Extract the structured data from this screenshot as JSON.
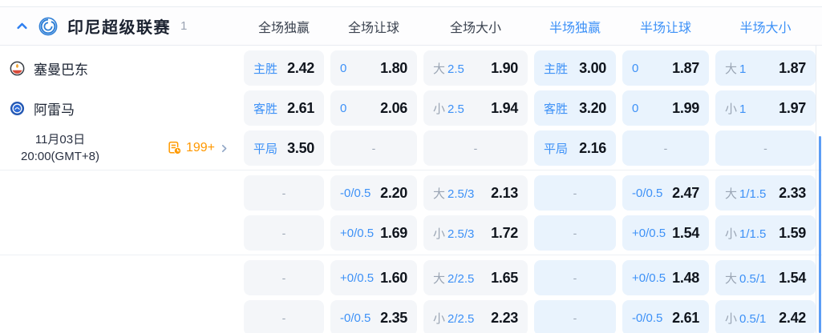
{
  "accent_color": "#3d91f7",
  "orange_color": "#ff9800",
  "header": {
    "league": "印尼超级联赛",
    "count": "1",
    "columns": [
      {
        "label": "全场独赢",
        "scope": "full"
      },
      {
        "label": "全场让球",
        "scope": "full"
      },
      {
        "label": "全场大小",
        "scope": "full"
      },
      {
        "label": "半场独赢",
        "scope": "half"
      },
      {
        "label": "半场让球",
        "scope": "half"
      },
      {
        "label": "半场大小",
        "scope": "half"
      }
    ]
  },
  "match": {
    "home_team": "塞曼巴东",
    "away_team": "阿雷马",
    "date": "11月03日",
    "time": "20:00(GMT+8)",
    "more_markets_count": "199+"
  },
  "icons": {
    "collapse": "chevron-up-icon",
    "league": "league-crest-icon",
    "home": "home-team-crest-icon",
    "away": "away-team-crest-icon",
    "markets": "markets-clock-icon",
    "more": "chevron-right-icon"
  },
  "groups": [
    {
      "rows": [
        {
          "left": "home",
          "cells": [
            {
              "label": "主胜",
              "value": "2.42"
            },
            {
              "label": "0",
              "value": "1.80"
            },
            {
              "prefix": "大",
              "label": "2.5",
              "value": "1.90"
            },
            {
              "label": "主胜",
              "value": "3.00"
            },
            {
              "label": "0",
              "value": "1.87"
            },
            {
              "prefix": "大",
              "label": "1",
              "value": "1.87"
            }
          ]
        },
        {
          "left": "away",
          "cells": [
            {
              "label": "客胜",
              "value": "2.61"
            },
            {
              "label": "0",
              "value": "2.06"
            },
            {
              "prefix": "小",
              "label": "2.5",
              "value": "1.94"
            },
            {
              "label": "客胜",
              "value": "3.20"
            },
            {
              "label": "0",
              "value": "1.99"
            },
            {
              "prefix": "小",
              "label": "1",
              "value": "1.97"
            }
          ]
        },
        {
          "left": "meta",
          "cells": [
            {
              "label": "平局",
              "value": "3.50"
            },
            {
              "dash": "-"
            },
            {
              "dash": "-"
            },
            {
              "label": "平局",
              "value": "2.16"
            },
            {
              "dash": "-"
            },
            {
              "dash": "-"
            }
          ]
        }
      ]
    },
    {
      "rows": [
        {
          "cells": [
            {
              "dash": "-"
            },
            {
              "label": "-0/0.5",
              "value": "2.20"
            },
            {
              "prefix": "大",
              "label": "2.5/3",
              "value": "2.13"
            },
            {
              "dash": "-"
            },
            {
              "label": "-0/0.5",
              "value": "2.47"
            },
            {
              "prefix": "大",
              "label": "1/1.5",
              "value": "2.33"
            }
          ]
        },
        {
          "cells": [
            {
              "dash": "-"
            },
            {
              "label": "+0/0.5",
              "value": "1.69"
            },
            {
              "prefix": "小",
              "label": "2.5/3",
              "value": "1.72"
            },
            {
              "dash": "-"
            },
            {
              "label": "+0/0.5",
              "value": "1.54"
            },
            {
              "prefix": "小",
              "label": "1/1.5",
              "value": "1.59"
            }
          ]
        }
      ]
    },
    {
      "rows": [
        {
          "cells": [
            {
              "dash": "-"
            },
            {
              "label": "+0/0.5",
              "value": "1.60"
            },
            {
              "prefix": "大",
              "label": "2/2.5",
              "value": "1.65"
            },
            {
              "dash": "-"
            },
            {
              "label": "+0/0.5",
              "value": "1.48"
            },
            {
              "prefix": "大",
              "label": "0.5/1",
              "value": "1.54"
            }
          ]
        },
        {
          "cells": [
            {
              "dash": "-"
            },
            {
              "label": "-0/0.5",
              "value": "2.35"
            },
            {
              "prefix": "小",
              "label": "2/2.5",
              "value": "2.23"
            },
            {
              "dash": "-"
            },
            {
              "label": "-0/0.5",
              "value": "2.61"
            },
            {
              "prefix": "小",
              "label": "0.5/1",
              "value": "2.42"
            }
          ]
        }
      ]
    }
  ]
}
